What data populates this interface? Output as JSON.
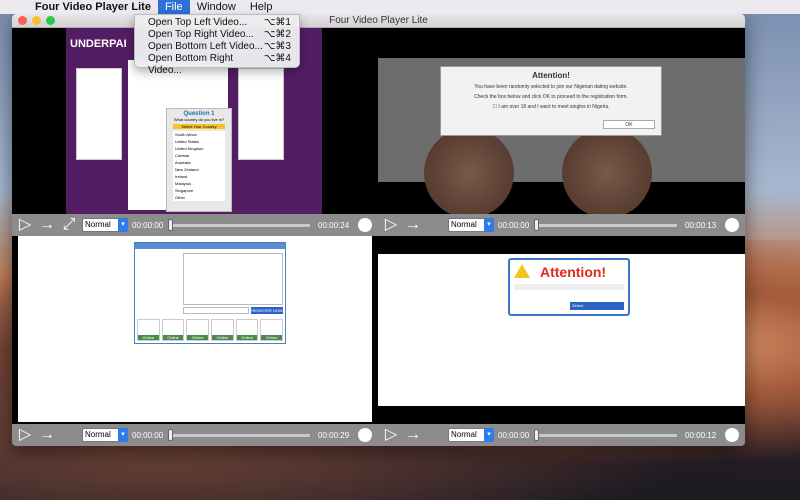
{
  "menubar": {
    "apple_glyph": "",
    "app_name": "Four Video Player Lite",
    "items": [
      "File",
      "Window",
      "Help"
    ]
  },
  "file_menu": [
    {
      "label": "Open Top Left Video...",
      "shortcut": "⌥⌘1"
    },
    {
      "label": "Open Top Right Video...",
      "shortcut": "⌥⌘2"
    },
    {
      "label": "Open Bottom Left Video...",
      "shortcut": "⌥⌘3"
    },
    {
      "label": "Open Bottom Right Video...",
      "shortcut": "⌥⌘4"
    }
  ],
  "window": {
    "title": "Four Video Player Lite"
  },
  "players": {
    "top_left": {
      "speed": "Normal",
      "current": "00:00:00",
      "duration": "00:00:24"
    },
    "top_right": {
      "speed": "Normal",
      "current": "00:00:00",
      "duration": "00:00:13"
    },
    "bottom_left": {
      "speed": "Normal",
      "current": "00:00:00",
      "duration": "00:00:29"
    },
    "bottom_right": {
      "speed": "Normal",
      "current": "00:00:00",
      "duration": "00:00:12"
    }
  },
  "video_tl": {
    "banner": "UNDERPAI",
    "question_title": "Question 1",
    "question_text": "What country do you live in?",
    "select_label": "Select Your Country",
    "countries": [
      "South Africa",
      "United States",
      "United Kingdom",
      "Canada",
      "Australia",
      "New Zealand",
      "Ireland",
      "Malaysia",
      "Singapore",
      "Other"
    ]
  },
  "video_tr": {
    "dialog_title": "Attention!",
    "line1": "You have been randomly selected to join our Nigerian dating website.",
    "line2": "Check the box below and click OK to proceed to the registration form.",
    "checkbox_label": "I am over 18 and I want to meet singles in Nigeria.",
    "ok_label": "OK"
  },
  "video_bl": {
    "register_label": "REGISTER NOW",
    "online_label": "Online"
  },
  "video_br": {
    "headline": "Attention!",
    "select_label": "Select"
  },
  "colors": {
    "accent": "#2f6fd8",
    "control_bar": "#8c8c8c"
  }
}
